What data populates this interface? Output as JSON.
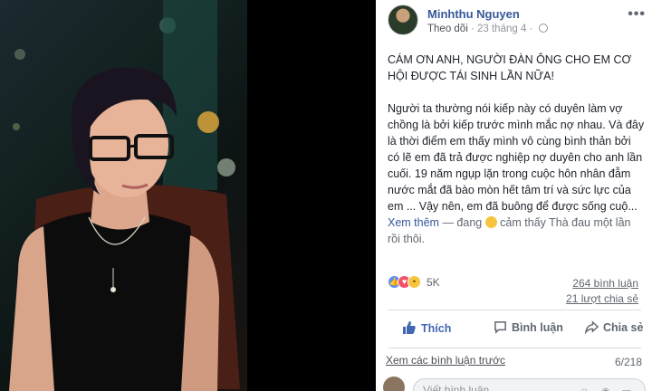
{
  "post": {
    "author": "Minhthu Nguyen",
    "follow_label": "Theo dõi",
    "date": "23 tháng 4",
    "more_label": "•••",
    "headline": "CÁM ƠN ANH, NGƯỜI ĐÀN ÔNG CHO EM CƠ HỘI ĐƯỢC TÁI SINH LẦN NỮA!",
    "body": "Người ta thường nói kiếp này có duyên làm vợ chồng là bởi kiếp trước mình mắc nợ nhau. Và đây là thời điểm em thấy mình vô cùng bình thản bởi có lẽ em đã trả được nghiệp nợ duyên cho anh lần cuối. 19 năm ngụp lặn trong cuộc hôn nhân đẫm nước mắt đã bào mòn hết tâm trí và sức lực của em ... Vậy nên, em đã buông để được sống cuộ...",
    "see_more": "Xem thêm",
    "feeling_prefix": " — đang ",
    "feeling_text": " cảm thấy Thà đau một lần rồi thôi."
  },
  "reactions": {
    "count": "5K",
    "icons": [
      "like-icon",
      "love-icon",
      "sad-icon"
    ]
  },
  "stats": {
    "comments": "264 bình luận",
    "shares": "21 lượt chia sẻ"
  },
  "actions": {
    "like": "Thích",
    "comment": "Bình luận",
    "share": "Chia sẻ"
  },
  "comments": {
    "view_previous": "Xem các bình luận trước",
    "pager": "6/218",
    "input_placeholder": "Viết bình luận..."
  },
  "colors": {
    "link": "#365899",
    "like_blue": "#4267b2",
    "muted": "#606770"
  }
}
